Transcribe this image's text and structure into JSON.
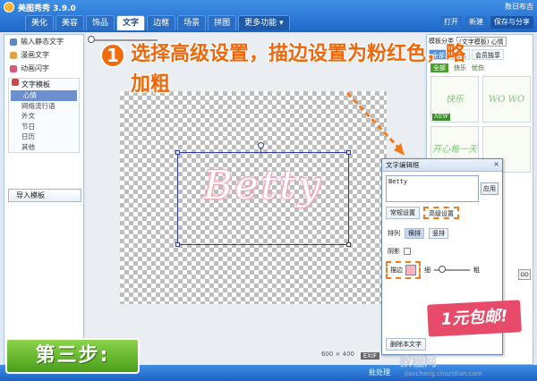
{
  "app": {
    "title": "美图秀秀 3.9.0"
  },
  "tabs": [
    "美化",
    "美容",
    "饰品",
    "文字",
    "边框",
    "场景",
    "拼图",
    "更多功能 ▾"
  ],
  "active_tab": "文字",
  "top_right": {
    "user": "数日布吉",
    "open": "打开",
    "new": "新建",
    "save_share": "保存与分享"
  },
  "left_panel": {
    "items": [
      {
        "label": "输入静态文字",
        "icon": "text-icon"
      },
      {
        "label": "漫画文字",
        "icon": "comic-icon"
      },
      {
        "label": "动画闪字",
        "icon": "flash-icon"
      }
    ],
    "template_header": "文字模板",
    "template_items": [
      "心情",
      "网络流行语",
      "外文",
      "节日",
      "日历",
      "其他"
    ],
    "selected_template": "心情",
    "import_button": "导入模板"
  },
  "canvas": {
    "toolbar": [
      "原图"
    ],
    "text": "Betty",
    "size_label": "600 × 400",
    "exif": "EXIF"
  },
  "right_panel": {
    "top_label": "模板分类",
    "select_value": "(文字模板) 心情",
    "tabs": [
      "全部",
      "我的",
      "会员独享"
    ],
    "active_tab": "全部",
    "sub_tabs": [
      "全部",
      "快乐",
      "忧伤"
    ],
    "active_sub": "全部",
    "thumbs": [
      {
        "text": "快乐",
        "new": true
      },
      {
        "text": "WO WO",
        "new": false
      },
      {
        "text": "开心每一天",
        "new": true
      },
      {
        "text": "",
        "new": false
      },
      {
        "text": "",
        "new": true
      },
      {
        "text": "",
        "new": false
      }
    ],
    "new_tag": "NEW",
    "go_label": "GO"
  },
  "dialog": {
    "title": "文字编辑框",
    "close": "×",
    "input_value": "Betty",
    "apply": "应用",
    "tab_normal": "常规设置",
    "tab_advanced": "高级设置",
    "arrange_label": "排列",
    "horizontal": "横排",
    "vertical": "竖排",
    "shadow_label": "阴影",
    "stroke_label": "描边",
    "thin": "细",
    "thick": "粗",
    "delete": "删除本文字"
  },
  "annotation": {
    "number": "1",
    "text": "选择高级设置，描边设置为粉红色，略加粗"
  },
  "step_banner": "第三步:",
  "promo": "1元包邮!",
  "status": {
    "batch": "批处理"
  },
  "watermark": {
    "main": "教程网",
    "url": "jiaocheng.chazidian.com"
  },
  "colors": {
    "accent": "#2b6fc4",
    "stroke_pink": "#f7b3c1",
    "annotation_orange": "#f0660a",
    "step_green": "#5cb32a"
  },
  "stroke_thickness_fraction": 0.15
}
